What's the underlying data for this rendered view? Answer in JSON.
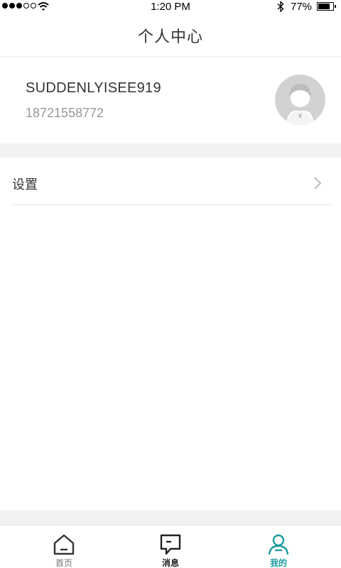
{
  "status_bar": {
    "time": "1:20 PM",
    "battery_percent": "77%",
    "battery_level": 0.77,
    "signal_bars_filled": 3,
    "signal_bars_total": 5
  },
  "header": {
    "title": "个人中心"
  },
  "profile": {
    "username": "SUDDENLYISEE919",
    "phone": "18721558772"
  },
  "menu": {
    "items": [
      {
        "label": "设置",
        "icon": "chevron-right-icon"
      }
    ]
  },
  "tab_bar": {
    "active_color": "#1a9ba1",
    "tabs": [
      {
        "label": "首页",
        "icon": "home-icon"
      },
      {
        "label": "消息",
        "icon": "message-icon"
      },
      {
        "label": "我的",
        "icon": "user-icon",
        "active": true
      }
    ]
  }
}
